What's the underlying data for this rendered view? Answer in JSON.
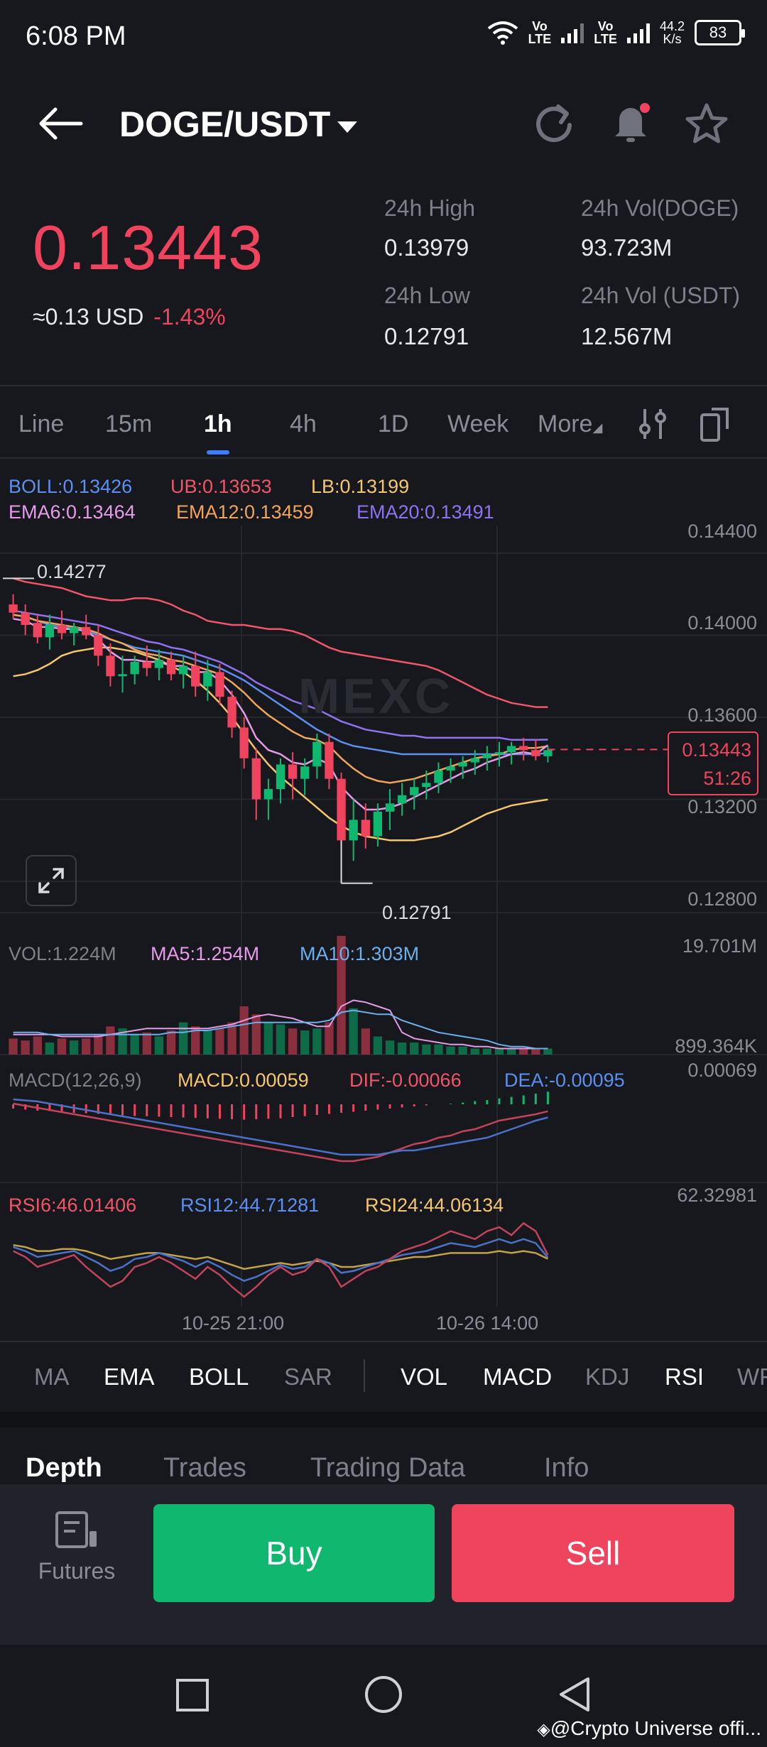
{
  "status": {
    "time": "6:08 PM",
    "net_speed_value": "44.2",
    "net_speed_unit": "K/s",
    "battery": "83",
    "lte1": "Vo\nLTE",
    "lte2": "Vo\nLTE"
  },
  "header": {
    "pair": "DOGE/USDT"
  },
  "ticker": {
    "last_price": "0.13443",
    "usd_equiv": "≈0.13 USD",
    "change": "-1.43%",
    "high_label": "24h High",
    "high_value": "0.13979",
    "low_label": "24h Low",
    "low_value": "0.12791",
    "vol_doge_label": "24h Vol(DOGE)",
    "vol_doge_value": "93.723M",
    "vol_usdt_label": "24h Vol (USDT)",
    "vol_usdt_value": "12.567M"
  },
  "timeframes": [
    "Line",
    "15m",
    "1h",
    "4h",
    "1D",
    "Week",
    "More"
  ],
  "main_legend": {
    "boll": "BOLL:0.13426",
    "ub": "UB:0.13653",
    "lb": "LB:0.13199",
    "ema6": "EMA6:0.13464",
    "ema12": "EMA12:0.13459",
    "ema20": "EMA20:0.13491"
  },
  "price_axis": [
    "0.14400",
    "0.14000",
    "0.13600",
    "0.13200",
    "0.12800"
  ],
  "price_tag": {
    "price": "0.13443",
    "countdown": "51:26"
  },
  "annotations": {
    "high": "0.14277",
    "low": "0.12791"
  },
  "watermark_logo": "MEXC",
  "volume": {
    "vol": "VOL:1.224M",
    "ma5": "MA5:1.254M",
    "ma10": "MA10:1.303M",
    "axis_top": "19.701M",
    "axis_bottom": "899.364K"
  },
  "macd": {
    "label": "MACD(12,26,9)",
    "macd": "MACD:0.00059",
    "dif": "DIF:-0.00066",
    "dea": "DEA:-0.00095",
    "axis_top": "0.00069"
  },
  "rsi": {
    "rsi6": "RSI6:46.01406",
    "rsi12": "RSI12:44.71281",
    "rsi24": "RSI24:44.06134",
    "axis_top": "62.32981"
  },
  "time_axis": [
    "10-25 21:00",
    "10-26 14:00"
  ],
  "indicators": [
    {
      "label": "MA",
      "active": false
    },
    {
      "label": "EMA",
      "active": true
    },
    {
      "label": "BOLL",
      "active": true
    },
    {
      "label": "SAR",
      "active": false
    },
    {
      "label": "VOL",
      "active": true
    },
    {
      "label": "MACD",
      "active": true
    },
    {
      "label": "KDJ",
      "active": false
    },
    {
      "label": "RSI",
      "active": true
    },
    {
      "label": "WR",
      "active": false
    }
  ],
  "bottom_tabs": [
    "Depth",
    "Trades",
    "Trading Data",
    "Info"
  ],
  "actions": {
    "futures": "Futures",
    "buy": "Buy",
    "sell": "Sell"
  },
  "watermark_credit": "@Crypto Universe offi...",
  "colors": {
    "up": "#10b86f",
    "down": "#f0445e",
    "accent": "#3d7bff",
    "bg": "#17181d"
  },
  "chart_data": {
    "type": "candlestick",
    "interval": "1h",
    "y_range": [
      0.127,
      0.145
    ],
    "candles": [
      [
        0.1415,
        0.142,
        0.1408,
        0.1411
      ],
      [
        0.1411,
        0.1415,
        0.14,
        0.1405
      ],
      [
        0.1406,
        0.141,
        0.1396,
        0.1399
      ],
      [
        0.1399,
        0.141,
        0.1393,
        0.1405
      ],
      [
        0.1405,
        0.1412,
        0.1398,
        0.1401
      ],
      [
        0.1401,
        0.1406,
        0.1395,
        0.1404
      ],
      [
        0.1404,
        0.141,
        0.1398,
        0.14
      ],
      [
        0.14,
        0.1405,
        0.1385,
        0.139
      ],
      [
        0.139,
        0.1396,
        0.1375,
        0.138
      ],
      [
        0.138,
        0.139,
        0.1372,
        0.1381
      ],
      [
        0.1381,
        0.139,
        0.1376,
        0.1387
      ],
      [
        0.1387,
        0.1395,
        0.138,
        0.1384
      ],
      [
        0.1384,
        0.1393,
        0.1378,
        0.1388
      ],
      [
        0.1388,
        0.1392,
        0.1378,
        0.1381
      ],
      [
        0.1381,
        0.139,
        0.1374,
        0.1385
      ],
      [
        0.1385,
        0.1392,
        0.137,
        0.1375
      ],
      [
        0.1375,
        0.1388,
        0.1368,
        0.1382
      ],
      [
        0.1382,
        0.1386,
        0.1366,
        0.137
      ],
      [
        0.137,
        0.1373,
        0.135,
        0.1355
      ],
      [
        0.1355,
        0.136,
        0.1335,
        0.134
      ],
      [
        0.134,
        0.1345,
        0.131,
        0.132
      ],
      [
        0.132,
        0.133,
        0.131,
        0.1325
      ],
      [
        0.1325,
        0.134,
        0.1318,
        0.1337
      ],
      [
        0.1337,
        0.1343,
        0.132,
        0.133
      ],
      [
        0.133,
        0.134,
        0.1322,
        0.1336
      ],
      [
        0.1336,
        0.1352,
        0.133,
        0.1348
      ],
      [
        0.1348,
        0.1352,
        0.1325,
        0.133
      ],
      [
        0.133,
        0.1333,
        0.1279,
        0.13
      ],
      [
        0.13,
        0.132,
        0.129,
        0.131
      ],
      [
        0.131,
        0.1318,
        0.1296,
        0.1302
      ],
      [
        0.1302,
        0.1318,
        0.1297,
        0.1314
      ],
      [
        0.1314,
        0.1325,
        0.1305,
        0.1318
      ],
      [
        0.1318,
        0.1328,
        0.1312,
        0.1322
      ],
      [
        0.1322,
        0.133,
        0.1315,
        0.1326
      ],
      [
        0.1326,
        0.1334,
        0.132,
        0.1328
      ],
      [
        0.1328,
        0.1338,
        0.1323,
        0.1334
      ],
      [
        0.1334,
        0.134,
        0.1328,
        0.1336
      ],
      [
        0.1336,
        0.1341,
        0.133,
        0.1338
      ],
      [
        0.1338,
        0.1344,
        0.1332,
        0.134
      ],
      [
        0.134,
        0.1346,
        0.1334,
        0.1342
      ],
      [
        0.1342,
        0.1348,
        0.1336,
        0.1343
      ],
      [
        0.1343,
        0.1348,
        0.1337,
        0.1346
      ],
      [
        0.1346,
        0.135,
        0.1339,
        0.1344
      ],
      [
        0.1344,
        0.1349,
        0.1339,
        0.1341
      ],
      [
        0.1341,
        0.1346,
        0.1338,
        0.1344
      ]
    ],
    "upper_band": [
      0.14277,
      0.1426,
      0.1425,
      0.1424,
      0.1423,
      0.1421,
      0.1419,
      0.1418,
      0.1417,
      0.1417,
      0.1418,
      0.1418,
      0.1417,
      0.1415,
      0.1412,
      0.141,
      0.1407,
      0.1406,
      0.1405,
      0.1405,
      0.1404,
      0.1403,
      0.1403,
      0.1402,
      0.14,
      0.1397,
      0.1394,
      0.1392,
      0.1391,
      0.139,
      0.1389,
      0.1388,
      0.1387,
      0.1386,
      0.1385,
      0.1383,
      0.138,
      0.1377,
      0.1374,
      0.1371,
      0.1369,
      0.1367,
      0.1366,
      0.1365,
      0.1365
    ],
    "lower_band": [
      0.138,
      0.1381,
      0.1383,
      0.1386,
      0.139,
      0.1392,
      0.1393,
      0.1394,
      0.1394,
      0.1393,
      0.1392,
      0.139,
      0.1388,
      0.1385,
      0.1382,
      0.1378,
      0.1373,
      0.1367,
      0.136,
      0.1352,
      0.1344,
      0.1337,
      0.1331,
      0.1326,
      0.1321,
      0.1316,
      0.1311,
      0.1307,
      0.1304,
      0.1302,
      0.1301,
      0.13,
      0.13,
      0.13,
      0.1301,
      0.1302,
      0.1304,
      0.1307,
      0.131,
      0.1313,
      0.1315,
      0.1317,
      0.1318,
      0.1319,
      0.13199
    ],
    "boll_mid": [
      0.141,
      0.1409,
      0.1407,
      0.1405,
      0.1404,
      0.1403,
      0.1402,
      0.14,
      0.1398,
      0.1396,
      0.1394,
      0.1393,
      0.1392,
      0.1391,
      0.139,
      0.1388,
      0.1386,
      0.1384,
      0.1381,
      0.1378,
      0.1374,
      0.137,
      0.1366,
      0.1362,
      0.1358,
      0.1354,
      0.1351,
      0.1348,
      0.1346,
      0.1345,
      0.1344,
      0.1343,
      0.1342,
      0.1342,
      0.1342,
      0.1342,
      0.1342,
      0.1342,
      0.1342,
      0.1342,
      0.1342,
      0.1342,
      0.1342,
      0.1342,
      0.13426
    ],
    "ema20": [
      0.1412,
      0.1411,
      0.141,
      0.1409,
      0.1408,
      0.1407,
      0.1406,
      0.1405,
      0.1403,
      0.1401,
      0.1399,
      0.1397,
      0.1396,
      0.1394,
      0.1393,
      0.1391,
      0.1389,
      0.1387,
      0.1384,
      0.1381,
      0.1377,
      0.1374,
      0.1371,
      0.1368,
      0.1366,
      0.1364,
      0.1361,
      0.1358,
      0.1356,
      0.1354,
      0.1353,
      0.1352,
      0.1351,
      0.1351,
      0.135,
      0.135,
      0.135,
      0.135,
      0.135,
      0.135,
      0.135,
      0.1349,
      0.1349,
      0.1349,
      0.13491
    ],
    "ema12": [
      0.141,
      0.1409,
      0.1407,
      0.1406,
      0.1405,
      0.1404,
      0.1403,
      0.1401,
      0.1398,
      0.1396,
      0.1393,
      0.1391,
      0.139,
      0.1388,
      0.1387,
      0.1385,
      0.1383,
      0.1381,
      0.1377,
      0.1372,
      0.1366,
      0.1361,
      0.1357,
      0.1353,
      0.135,
      0.1349,
      0.1346,
      0.134,
      0.1335,
      0.1331,
      0.1329,
      0.1328,
      0.1329,
      0.133,
      0.1332,
      0.1334,
      0.1336,
      0.1338,
      0.134,
      0.1341,
      0.1342,
      0.1344,
      0.1345,
      0.1345,
      0.13459
    ],
    "ema6": [
      0.1408,
      0.1407,
      0.1404,
      0.1404,
      0.1403,
      0.1403,
      0.1402,
      0.1398,
      0.1392,
      0.1388,
      0.1388,
      0.1387,
      0.1387,
      0.1385,
      0.1385,
      0.1382,
      0.1382,
      0.1378,
      0.1371,
      0.1362,
      0.135,
      0.1344,
      0.1342,
      0.1338,
      0.1337,
      0.134,
      0.1337,
      0.1326,
      0.132,
      0.1315,
      0.1315,
      0.1316,
      0.1318,
      0.1321,
      0.1324,
      0.1327,
      0.133,
      0.1333,
      0.1335,
      0.1338,
      0.134,
      0.1342,
      0.1343,
      0.1342,
      0.13464
    ],
    "volume_max_label": "19.701M",
    "volumes": [
      0.8,
      0.7,
      0.9,
      0.6,
      0.8,
      0.7,
      0.8,
      1.0,
      1.4,
      1.3,
      1.0,
      1.1,
      0.9,
      1.2,
      1.6,
      1.4,
      1.2,
      1.3,
      1.6,
      2.4,
      2.0,
      1.6,
      1.5,
      1.3,
      1.2,
      1.3,
      1.6,
      5.9,
      2.3,
      1.3,
      0.9,
      0.7,
      0.6,
      0.6,
      0.5,
      0.5,
      0.4,
      0.4,
      0.3,
      0.3,
      0.3,
      0.3,
      0.3,
      0.3,
      0.3
    ],
    "vol_ma5": [
      1.0,
      1.0,
      1.0,
      1.0,
      0.9,
      0.9,
      0.9,
      0.9,
      1.0,
      1.1,
      1.2,
      1.3,
      1.3,
      1.3,
      1.3,
      1.3,
      1.3,
      1.4,
      1.5,
      1.7,
      1.9,
      2.0,
      1.9,
      1.8,
      1.6,
      1.4,
      1.4,
      2.4,
      2.7,
      2.6,
      2.4,
      2.2,
      1.1,
      0.8,
      0.7,
      0.6,
      0.5,
      0.5,
      0.4,
      0.4,
      0.3,
      0.3,
      0.3,
      0.3,
      0.3
    ],
    "vol_ma10": [
      1.1,
      1.1,
      1.1,
      1.0,
      1.0,
      1.0,
      1.0,
      1.0,
      1.0,
      1.0,
      1.0,
      1.0,
      1.0,
      1.1,
      1.1,
      1.2,
      1.2,
      1.3,
      1.4,
      1.5,
      1.6,
      1.6,
      1.6,
      1.6,
      1.6,
      1.6,
      1.7,
      2.1,
      2.2,
      2.1,
      2.0,
      2.0,
      1.7,
      1.5,
      1.3,
      1.1,
      1.0,
      0.9,
      0.8,
      0.7,
      0.5,
      0.4,
      0.4,
      0.3,
      0.3
    ],
    "macd_hist": [
      -0.0002,
      -0.00025,
      -0.0003,
      -0.00032,
      -0.00035,
      -0.0004,
      -0.00042,
      -0.00045,
      -0.0005,
      -0.00052,
      -0.00055,
      -0.00056,
      -0.00058,
      -0.0006,
      -0.00062,
      -0.00064,
      -0.00066,
      -0.00068,
      -0.0007,
      -0.00072,
      -0.0007,
      -0.00068,
      -0.00066,
      -0.0006,
      -0.00056,
      -0.0005,
      -0.00045,
      -0.0004,
      -0.00035,
      -0.0003,
      -0.00025,
      -0.0002,
      -0.00015,
      -0.0001,
      -5e-05,
      0.0,
      3e-05,
      8e-05,
      0.00015,
      0.0002,
      0.00028,
      0.00035,
      0.00042,
      0.0005,
      0.00059
    ],
    "macd_dif": [
      -0.0003,
      -0.0004,
      -0.0005,
      -0.0006,
      -0.0007,
      -0.0008,
      -0.0009,
      -0.001,
      -0.0011,
      -0.0012,
      -0.0013,
      -0.0014,
      -0.0015,
      -0.0016,
      -0.0017,
      -0.0018,
      -0.0019,
      -0.002,
      -0.0021,
      -0.0022,
      -0.0023,
      -0.0024,
      -0.0025,
      -0.0026,
      -0.0027,
      -0.0028,
      -0.0029,
      -0.003,
      -0.003,
      -0.0029,
      -0.0028,
      -0.0026,
      -0.0024,
      -0.0022,
      -0.0021,
      -0.0019,
      -0.0018,
      -0.0016,
      -0.0015,
      -0.0013,
      -0.0011,
      -0.001,
      -0.0009,
      -0.0008,
      -0.00066
    ],
    "macd_dea": [
      -0.0001,
      -0.00015,
      -0.0002,
      -0.0003,
      -0.0004,
      -0.0005,
      -0.0006,
      -0.0007,
      -0.0008,
      -0.0009,
      -0.001,
      -0.0011,
      -0.0012,
      -0.0013,
      -0.0014,
      -0.0015,
      -0.0016,
      -0.0017,
      -0.0018,
      -0.0019,
      -0.002,
      -0.0021,
      -0.0022,
      -0.0023,
      -0.0024,
      -0.0025,
      -0.0026,
      -0.0027,
      -0.0027,
      -0.0027,
      -0.0027,
      -0.0026,
      -0.0025,
      -0.0025,
      -0.0024,
      -0.0023,
      -0.0022,
      -0.0021,
      -0.002,
      -0.0019,
      -0.0017,
      -0.0015,
      -0.0013,
      -0.0011,
      -0.00095
    ],
    "rsi6": [
      48,
      45,
      40,
      42,
      44,
      46,
      40,
      35,
      30,
      33,
      40,
      42,
      45,
      42,
      38,
      34,
      40,
      36,
      30,
      25,
      30,
      36,
      40,
      36,
      38,
      44,
      40,
      30,
      34,
      38,
      40,
      44,
      48,
      50,
      52,
      55,
      58,
      56,
      54,
      58,
      60,
      56,
      62,
      58,
      46.01406
    ],
    "rsi12": [
      50,
      48,
      45,
      46,
      47,
      48,
      45,
      42,
      38,
      40,
      44,
      45,
      47,
      45,
      43,
      40,
      43,
      40,
      36,
      33,
      35,
      38,
      41,
      39,
      40,
      44,
      42,
      37,
      38,
      40,
      42,
      44,
      46,
      47,
      48,
      50,
      52,
      51,
      50,
      52,
      54,
      52,
      54,
      52,
      44.71281
    ],
    "rsi24": [
      51,
      50,
      48,
      48,
      49,
      49,
      48,
      46,
      44,
      45,
      46,
      47,
      47,
      46,
      45,
      44,
      45,
      43,
      41,
      39,
      40,
      41,
      42,
      41,
      42,
      43,
      42,
      40,
      40,
      41,
      42,
      43,
      44,
      45,
      45,
      46,
      47,
      47,
      47,
      47,
      48,
      47,
      48,
      47,
      44.06134
    ],
    "x_ticks": [
      "10-25 21:00",
      "10-26 14:00"
    ]
  }
}
